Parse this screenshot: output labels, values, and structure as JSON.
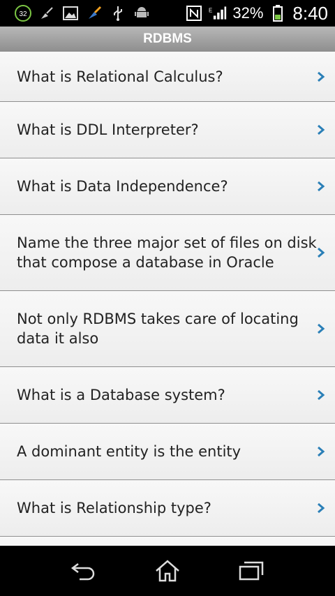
{
  "status": {
    "notif_badge": "32",
    "battery_pct": "32%",
    "time": "8:40"
  },
  "title": "RDBMS",
  "items": [
    {
      "label": "What is Relational Calculus?"
    },
    {
      "label": "What is DDL Interpreter?"
    },
    {
      "label": "What is Data Independence?"
    },
    {
      "label": "Name the three major set of files on disk that compose a database in Oracle"
    },
    {
      "label": "Not only RDBMS takes care of locating data it also"
    },
    {
      "label": "What is a Database system?"
    },
    {
      "label": "A dominant entity is the entity"
    },
    {
      "label": "What is Relationship type?"
    }
  ],
  "icons": {
    "chevron": "chevron-right-icon",
    "back": "back-icon",
    "home": "home-icon",
    "recents": "recent-apps-icon"
  },
  "colors": {
    "chevron": "#2a7fb7",
    "titlebar": "#9d9d9d",
    "status_bg": "#000000"
  }
}
